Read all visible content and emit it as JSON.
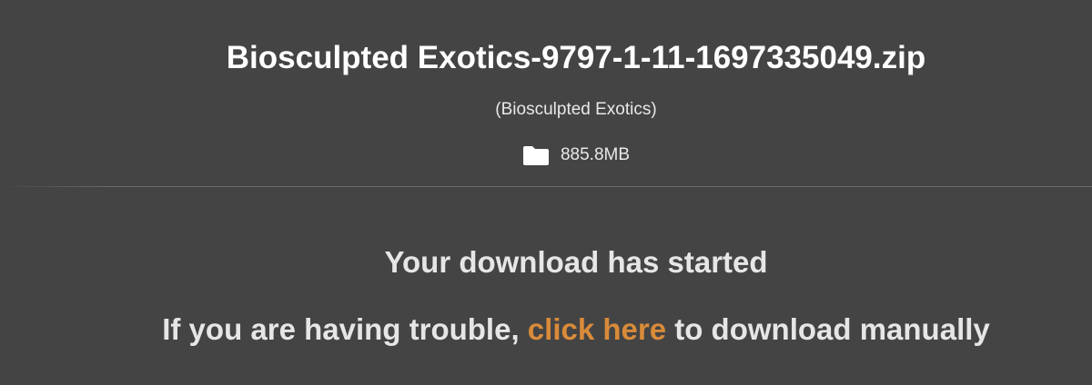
{
  "file": {
    "name": "Biosculpted Exotics-9797-1-11-1697335049.zip",
    "category": "(Biosculpted Exotics)",
    "size": "885.8MB",
    "size_icon": "folder-icon"
  },
  "download": {
    "status_text": "Your download has started",
    "trouble_prefix": "If you are having trouble, ",
    "link_text": "click here",
    "trouble_suffix": " to download manually"
  },
  "colors": {
    "background": "#444444",
    "link": "#d98b3a",
    "text": "#ffffff"
  }
}
